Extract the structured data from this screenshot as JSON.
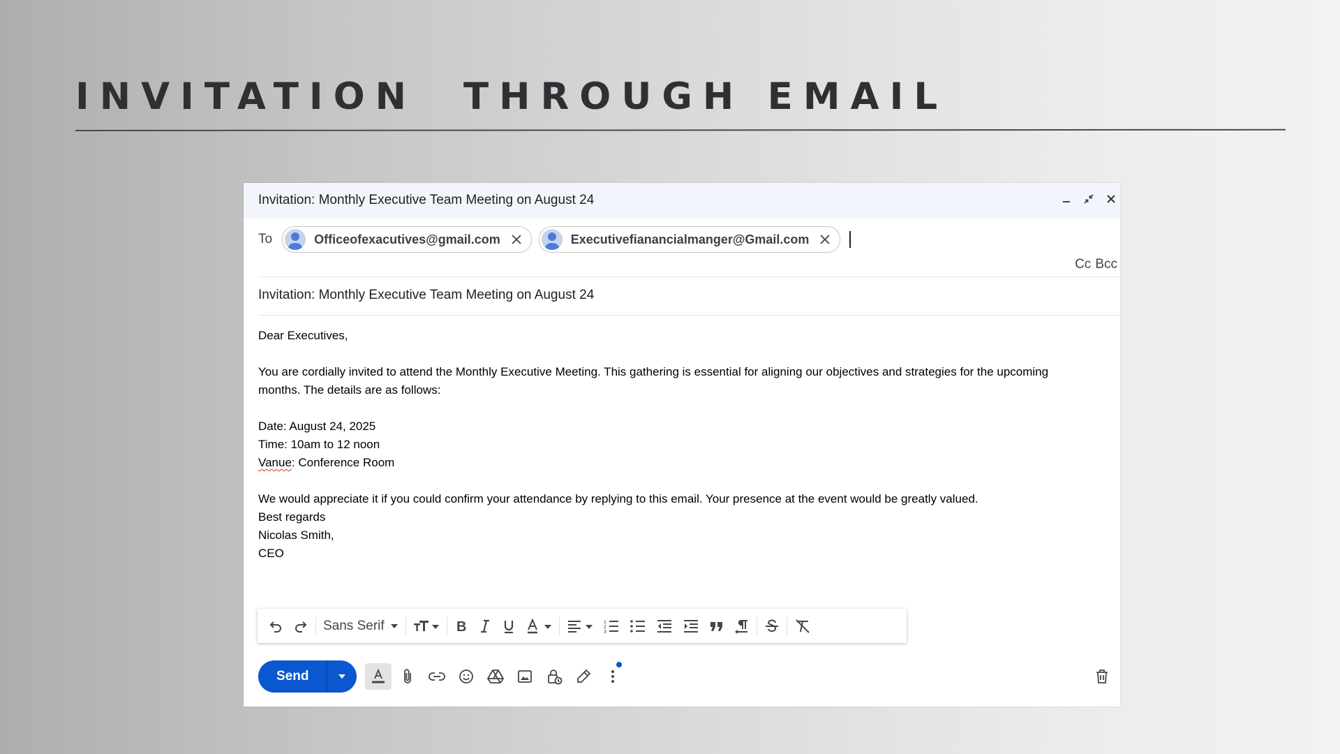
{
  "slide": {
    "title": "INVITATION  THROUGH EMAIL"
  },
  "compose": {
    "header_title": "Invitation: Monthly Executive Team Meeting on August 24",
    "to_label": "To",
    "recipients": [
      "Officeofexacutives@gmail.com",
      "Executivefianancialmanger@Gmail.com"
    ],
    "cc_label": "Cc",
    "bcc_label": "Bcc",
    "subject": "Invitation: Monthly Executive Team Meeting on August 24",
    "body": {
      "greeting": "Dear Executives,",
      "intro_line1": "You are cordially invited to attend the Monthly Executive Meeting. This gathering is essential for aligning our objectives and strategies for the upcoming",
      "intro_line2": "months. The details are as follows:",
      "date": "Date: August 24, 2025",
      "time": "Time: 10am to 12 noon",
      "venue_word": "Vanue",
      "venue_rest": ": Conference Room",
      "closing": "We would appreciate it if you could confirm your attendance by replying to this email. Your presence at the event would be greatly valued.",
      "regards": "Best regards",
      "signature_name": "Nicolas Smith,",
      "signature_title": "CEO"
    },
    "toolbar": {
      "font": "Sans Serif",
      "icons": [
        "undo-icon",
        "redo-icon",
        "font-size-icon",
        "bold-icon",
        "italic-icon",
        "underline-icon",
        "text-color-icon",
        "align-icon",
        "numbered-list-icon",
        "bulleted-list-icon",
        "indent-less-icon",
        "indent-more-icon",
        "quote-icon",
        "rtl-icon",
        "strikethrough-icon",
        "clear-formatting-icon"
      ]
    },
    "send_label": "Send",
    "bottom_icons": [
      "formatting-options-icon",
      "attach-icon",
      "link-icon",
      "emoji-icon",
      "drive-icon",
      "photo-icon",
      "confidential-icon",
      "signature-icon",
      "more-options-icon",
      "discard-icon"
    ],
    "colors": {
      "send": "#0b57d0",
      "header_bg": "#f2f6fc",
      "notification_dot": "#0b57d0"
    }
  }
}
